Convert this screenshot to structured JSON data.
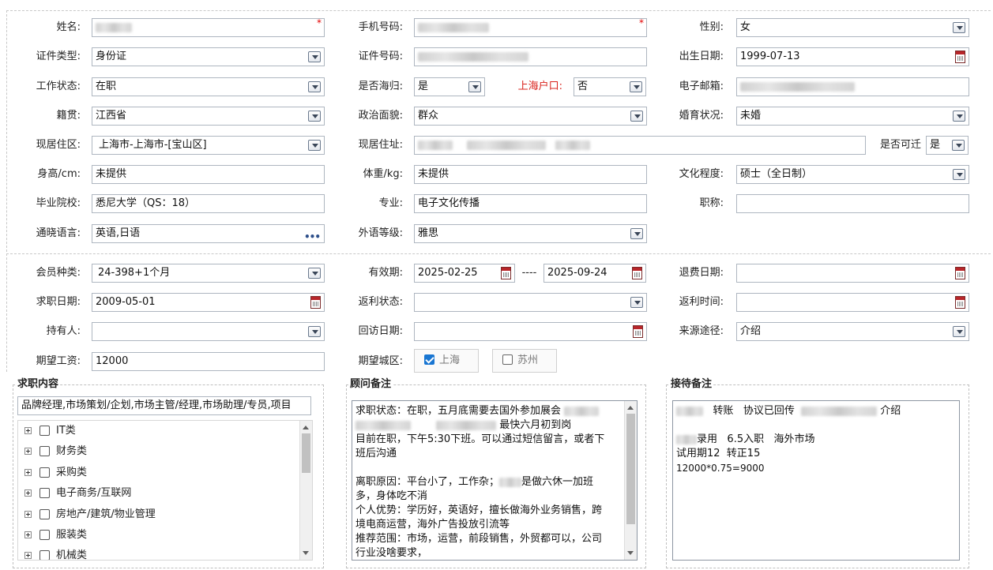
{
  "personal": {
    "name_label": "姓名:",
    "phone_label": "手机号码:",
    "gender_label": "性别:",
    "gender_value": "女",
    "id_type_label": "证件类型:",
    "id_type_value": "身份证",
    "id_number_label": "证件号码:",
    "birth_label": "出生日期:",
    "birth_value": "1999-07-13",
    "work_status_label": "工作状态:",
    "work_status_value": "在职",
    "returnee_label": "是否海归:",
    "returnee_value": "是",
    "hukou_label": "上海户口:",
    "hukou_value": "否",
    "email_label": "电子邮箱:",
    "origin_label": "籍贯:",
    "origin_value": "江西省",
    "political_label": "政治面貌:",
    "political_value": "群众",
    "marital_label": "婚育状况:",
    "marital_value": "未婚",
    "district_label": "现居住区:",
    "district_value": "上海市-上海市-[宝山区]",
    "address_label": "现居住址:",
    "relocate_label": "是否可迁",
    "relocate_value": "是",
    "height_label": "身高/cm:",
    "height_value": "未提供",
    "weight_label": "体重/kg:",
    "weight_value": "未提供",
    "education_label": "文化程度:",
    "education_value": "硕士（全日制）",
    "school_label": "毕业院校:",
    "school_value": "悉尼大学（QS：18）",
    "major_label": "专业:",
    "major_value": "电子文化传播",
    "title_label": "职称:",
    "title_value": "",
    "language_label": "通晓语言:",
    "language_value": "英语,日语",
    "lang_level_label": "外语等级:",
    "lang_level_value": "雅思"
  },
  "membership": {
    "type_label": "会员种类:",
    "type_value": "24-398+1个月",
    "validity_label": "有效期:",
    "validity_start": "2025-02-25",
    "validity_sep": "----",
    "validity_end": "2025-09-24",
    "refund_label": "退费日期:",
    "refund_value": "",
    "jobsearch_label": "求职日期:",
    "jobsearch_value": "2009-05-01",
    "rebate_status_label": "返利状态:",
    "rebate_status_value": "",
    "rebate_time_label": "返利时间:",
    "rebate_time_value": "",
    "holder_label": "持有人:",
    "holder_value": "",
    "revisit_label": "回访日期:",
    "revisit_value": "",
    "source_label": "来源途径:",
    "source_value": "介绍",
    "salary_label": "期望工资:",
    "salary_value": "12000",
    "city_label": "期望城区:",
    "cities": [
      {
        "label": "上海",
        "checked": true
      },
      {
        "label": "苏州",
        "checked": false
      }
    ]
  },
  "job_panel": {
    "title": "求职内容",
    "summary": "品牌经理,市场策划/企划,市场主管/经理,市场助理/专员,项目",
    "categories": [
      "IT类",
      "财务类",
      "采购类",
      "电子商务/互联网",
      "房地产/建筑/物业管理",
      "服装类",
      "机械类"
    ]
  },
  "advisor_panel": {
    "title": "顾问备注",
    "line1": "求职状态：在职，五月底需要去国外参加展会",
    "line2": "最快六月初到岗",
    "line3": "目前在职，下午5:30下班。可以通过短信留言，或者下",
    "line4": "班后沟通",
    "line5": "离职原因：平台小了，工作杂；",
    "line5b": "是做六休一加班",
    "line6": "多，身体吃不消",
    "line7": "个人优势：学历好，英语好，擅长做海外业务销售，跨",
    "line8": "境电商运营，海外广告投放引流等",
    "line9": "推荐范围：市场，运营，前段销售，外贸都可以，公司",
    "line10": "行业没啥要求，"
  },
  "reception_panel": {
    "title": "接待备注",
    "line1a": "转账",
    "line1b": "协议已回传",
    "line1c": "介绍",
    "line2a": "录用",
    "line2b": "6.5入职",
    "line2c": "海外市场",
    "line3": "试用期12  转正15",
    "line4": "12000*0.75=9000"
  },
  "colors": {
    "label_red": "#d9231c",
    "required": "#e30000",
    "check_blue": "#1976d2"
  }
}
